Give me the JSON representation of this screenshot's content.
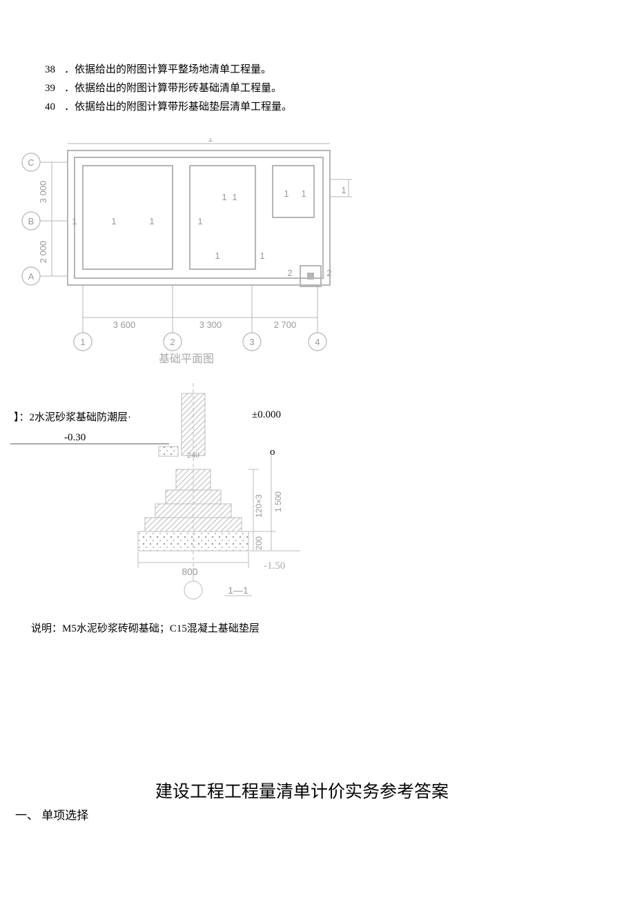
{
  "questions": [
    {
      "num": "38",
      "text": "．依据给出的附图计算平整场地清单工程量。"
    },
    {
      "num": "39",
      "text": "．依据给出的附图计算带形砖基础清单工程量。"
    },
    {
      "num": "40",
      "text": "．依据给出的附图计算带形基础垫层清单工程量。"
    }
  ],
  "plan": {
    "axis_letters": [
      "C",
      "B",
      "A"
    ],
    "axis_numbers": [
      "1",
      "2",
      "3",
      "4"
    ],
    "v_dims": [
      "3 000",
      "2 000"
    ],
    "h_dims": [
      "3 600",
      "3 300",
      "2 700"
    ],
    "caption": "基础平面图",
    "room_marks": [
      "1",
      "1",
      "1",
      "1",
      "1",
      "1",
      "1",
      "1",
      "1",
      "1",
      "1",
      "2",
      "2"
    ]
  },
  "section": {
    "damp_proof_label": "】：2水泥砂浆基础防潮层·",
    "elev_zero": "±0.000",
    "elev_neg030": "-0.30",
    "o_mark": "o",
    "dim_240": "240",
    "dim_120x3": "120×3",
    "dim_200": "200",
    "dim_1500": "1 500",
    "dim_800": "800",
    "elev_neg150": "-1.50",
    "section_label": "1—1"
  },
  "note": "说明：M5水泥砂浆砖砌基础；C15混凝土基础垫层",
  "answer_title": "建设工程工程量清单计价实务参考答案",
  "answer_section": "一、  单项选择"
}
